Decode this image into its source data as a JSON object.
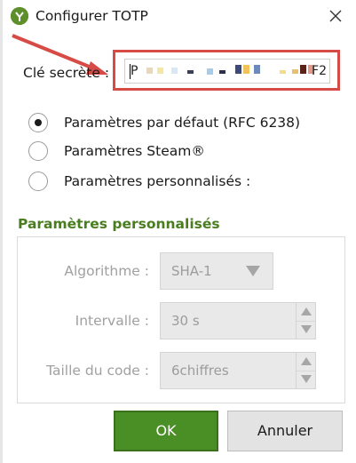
{
  "window": {
    "title": "Configurer TOTP"
  },
  "secret": {
    "label": "Clé secrète :",
    "value_prefix": "P",
    "value_suffix": "F2"
  },
  "radios": [
    {
      "label": "Paramètres par défaut (RFC 6238)",
      "selected": true
    },
    {
      "label": "Paramètres Steam®",
      "selected": false
    },
    {
      "label": "Paramètres personnalisés :",
      "selected": false
    }
  ],
  "custom": {
    "title": "Paramètres personnalisés",
    "algorithm": {
      "label": "Algorithme :",
      "value": "SHA-1"
    },
    "interval": {
      "label": "Intervalle :",
      "value": "30 s"
    },
    "code_size": {
      "label": "Taille du code :",
      "value": "6chiffres"
    }
  },
  "buttons": {
    "ok": "OK",
    "cancel": "Annuler"
  },
  "colors": {
    "accent_green": "#4a8f25",
    "annotation_red": "#d64b45",
    "group_title_green": "#4a7d20"
  },
  "icons": {
    "app": "keepass-icon",
    "close": "close-icon",
    "dropdown": "triangle-down-icon"
  }
}
